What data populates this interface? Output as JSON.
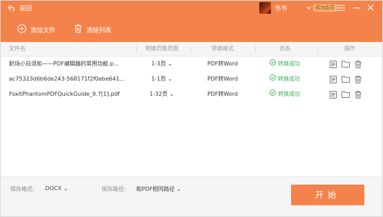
{
  "header": {
    "back_label": "返回",
    "user_name": "书书",
    "vip_badge": "成功会员",
    "add_file_label": "添加文件",
    "clear_list_label": "清除列表"
  },
  "table": {
    "columns": [
      "文件名",
      "转换页数范围",
      "转换格式",
      "状态",
      "操作"
    ],
    "rows": [
      {
        "name": "职场小白须知——PDF编辑器的常用功能.p...",
        "range": "1-3页",
        "format": "PDF转Word",
        "status": "转换成功"
      },
      {
        "name": "ac75323d6b6de243-568171f2f0ebe641...",
        "range": "1-1页",
        "format": "PDF转Word",
        "status": "转换成功"
      },
      {
        "name": "FoxitPhantomPDFQuickGuide_9.7[1].pdf",
        "range": "1-32页",
        "format": "PDF转Word",
        "status": "转换成功"
      }
    ]
  },
  "footer": {
    "save_format_label": "保存格式:",
    "save_format_value": ".DOCX",
    "save_path_label": "保存路径:",
    "save_path_value": "和PDF相同路径",
    "start_label": "开始"
  },
  "colors": {
    "accent": "#f4834b",
    "success": "#3bb35a"
  },
  "icons": {
    "back": "back-arrow-icon",
    "add": "plus-circle-icon",
    "clear": "trash-icon",
    "status": "check-circle-icon",
    "actions": [
      "document-icon",
      "folder-icon",
      "trash-icon"
    ],
    "window": [
      "menu-icon",
      "minimize-icon",
      "close-icon"
    ]
  }
}
